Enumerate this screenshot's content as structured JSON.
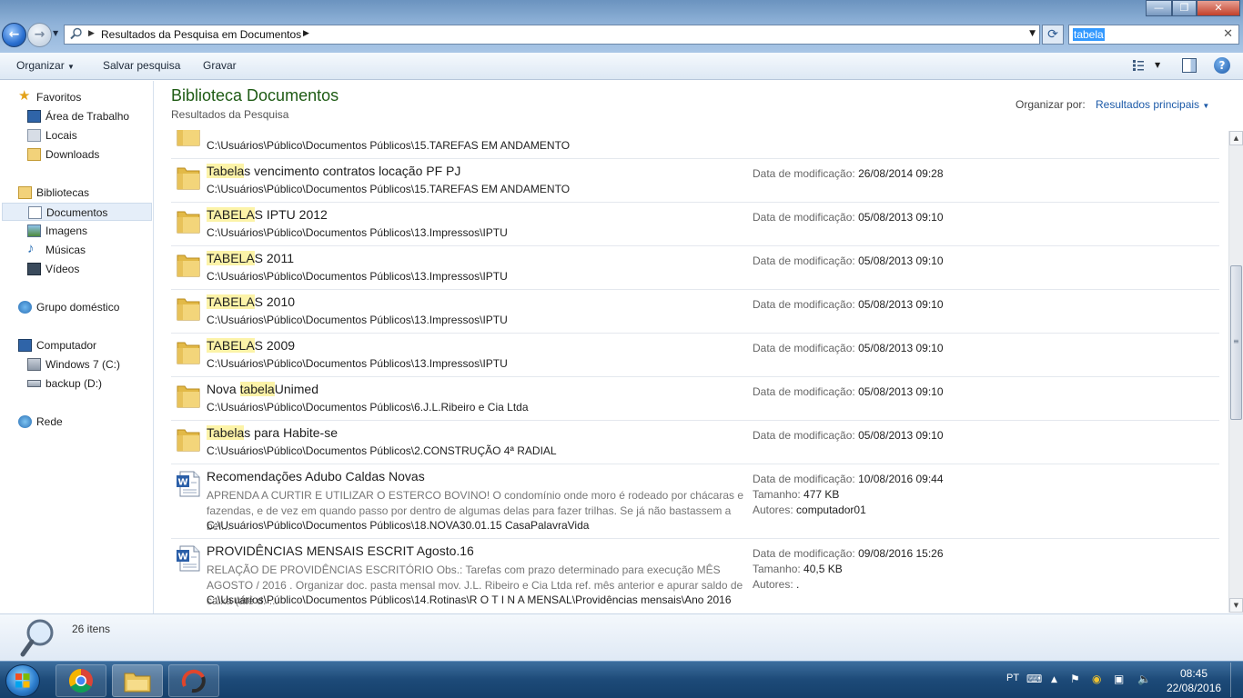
{
  "window": {
    "address_crumb": "Resultados da Pesquisa em Documentos",
    "search_value": "tabela"
  },
  "toolbar": {
    "organize_label": "Organizar",
    "save_search_label": "Salvar pesquisa",
    "burn_label": "Gravar"
  },
  "nav": {
    "favorites": "Favoritos",
    "desktop": "Área de Trabalho",
    "places": "Locais",
    "downloads": "Downloads",
    "libraries": "Bibliotecas",
    "documents": "Documentos",
    "images": "Imagens",
    "music": "Músicas",
    "videos": "Vídeos",
    "homegroup": "Grupo doméstico",
    "computer": "Computador",
    "drive_c": "Windows 7 (C:)",
    "drive_d": "backup (D:)",
    "network": "Rede"
  },
  "header": {
    "library_title": "Biblioteca Documentos",
    "subtitle": "Resultados da Pesquisa",
    "arrange_label": "Organizar por:",
    "arrange_value": "Resultados principais"
  },
  "results": {
    "modified_label": "Data de modificação:",
    "size_label": "Tamanho:",
    "authors_label": "Autores:",
    "items": [
      {
        "type": "folder",
        "name_pre": "",
        "name_hl": "",
        "name_post": "",
        "path": "C:\\Usuários\\Público\\Documentos Públicos\\15.TAREFAS EM ANDAMENTO",
        "modified": "",
        "partial": true
      },
      {
        "type": "folder",
        "name_pre": "",
        "name_hl": "Tabela",
        "name_post": "s vencimento contratos locação PF PJ",
        "path": "C:\\Usuários\\Público\\Documentos Públicos\\15.TAREFAS EM ANDAMENTO",
        "modified": "26/08/2014 09:28"
      },
      {
        "type": "folder",
        "name_pre": "",
        "name_hl": "TABELA",
        "name_post": "S IPTU 2012",
        "path": "C:\\Usuários\\Público\\Documentos Públicos\\13.Impressos\\IPTU",
        "modified": "05/08/2013 09:10"
      },
      {
        "type": "folder",
        "name_pre": "",
        "name_hl": "TABELA",
        "name_post": "S 2011",
        "path": "C:\\Usuários\\Público\\Documentos Públicos\\13.Impressos\\IPTU",
        "modified": "05/08/2013 09:10"
      },
      {
        "type": "folder",
        "name_pre": "",
        "name_hl": "TABELA",
        "name_post": "S 2010",
        "path": "C:\\Usuários\\Público\\Documentos Públicos\\13.Impressos\\IPTU",
        "modified": "05/08/2013 09:10"
      },
      {
        "type": "folder",
        "name_pre": "",
        "name_hl": "TABELA",
        "name_post": "S 2009",
        "path": "C:\\Usuários\\Público\\Documentos Públicos\\13.Impressos\\IPTU",
        "modified": "05/08/2013 09:10"
      },
      {
        "type": "folder",
        "name_pre": "Nova ",
        "name_hl": "tabela",
        "name_post": "Unimed",
        "path": "C:\\Usuários\\Público\\Documentos Públicos\\6.J.L.Ribeiro e Cia Ltda",
        "modified": "05/08/2013 09:10"
      },
      {
        "type": "folder",
        "name_pre": "",
        "name_hl": "Tabela",
        "name_post": "s para Habite-se",
        "path": "C:\\Usuários\\Público\\Documentos Públicos\\2.CONSTRUÇÃO 4ª RADIAL",
        "modified": "05/08/2013 09:10"
      },
      {
        "type": "doc",
        "name_pre": "Recomendações Adubo Caldas Novas",
        "name_hl": "",
        "name_post": "",
        "snippet": "APRENDA A CURTIR E UTILIZAR O ESTERCO BOVINO! O condomínio onde moro é rodeado por chácaras e fazendas, e de vez em quando passo por dentro de algumas delas para fazer trilhas. Se já não bastassem a bel...",
        "path": "C:\\Usuários\\Público\\Documentos Públicos\\18.NOVA30.01.15 CasaPalavraVida",
        "modified": "10/08/2016 09:44",
        "size": "477 KB",
        "authors": "computador01"
      },
      {
        "type": "doc",
        "name_pre": "PROVIDÊNCIAS MENSAIS ESCRIT Agosto.16",
        "name_hl": "",
        "name_post": "",
        "snippet": "RELAÇÃO DE PROVIDÊNCIAS ESCRITÓRIO Obs.: Tarefas com prazo determinado para execução MÊS AGOSTO / 2016 . Organizar doc. pasta mensal mov. J.L. Ribeiro e Cia Ltda ref. mês anterior e apurar saldo de caixa (até d. ...",
        "path": "C:\\Usuários\\Público\\Documentos Públicos\\14.Rotinas\\R O T I N A  MENSAL\\Providências mensais\\Ano 2016",
        "modified": "09/08/2016 15:26",
        "size": "40,5 KB",
        "authors": "."
      }
    ]
  },
  "details": {
    "item_count": "26 itens"
  },
  "taskbar": {
    "lang": "PT",
    "time": "08:45",
    "date": "22/08/2016"
  }
}
